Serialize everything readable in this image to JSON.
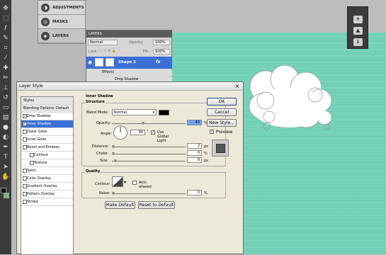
{
  "panels": {
    "dock": [
      {
        "label": "ADJUSTMENTS",
        "icon": "adjustments-icon"
      },
      {
        "label": "MASKS",
        "icon": "masks-icon"
      },
      {
        "label": "LAYERS",
        "icon": "layers-icon"
      }
    ],
    "layers": {
      "tab": "LAYERS",
      "blend_mode": "Normal",
      "opacity_label": "Opacity:",
      "opacity_value": "100%",
      "lock_label": "Lock:",
      "fill_label": "Fill:",
      "fill_value": "100%",
      "layer_name": "Shape 2",
      "fx_label": "fx",
      "effects_label": "Effects",
      "drop_shadow_label": "Drop Shadow"
    }
  },
  "dialog": {
    "title": "Layer Style",
    "styles_header": "Styles",
    "items": [
      {
        "label": "Blending Options: Default",
        "checked": null,
        "kind": "hdr"
      },
      {
        "label": "Drop Shadow",
        "checked": true,
        "kind": "main"
      },
      {
        "label": "Inner Shadow",
        "checked": true,
        "kind": "sel"
      },
      {
        "label": "Outer Glow",
        "checked": false,
        "kind": "main"
      },
      {
        "label": "Inner Glow",
        "checked": false,
        "kind": "main"
      },
      {
        "label": "Bevel and Emboss",
        "checked": false,
        "kind": "main"
      },
      {
        "label": "Contour",
        "checked": false,
        "kind": "sub"
      },
      {
        "label": "Texture",
        "checked": false,
        "kind": "sub"
      },
      {
        "label": "Satin",
        "checked": false,
        "kind": "main"
      },
      {
        "label": "Color Overlay",
        "checked": false,
        "kind": "main"
      },
      {
        "label": "Gradient Overlay",
        "checked": false,
        "kind": "main"
      },
      {
        "label": "Pattern Overlay",
        "checked": false,
        "kind": "main"
      },
      {
        "label": "Stroke",
        "checked": false,
        "kind": "main"
      }
    ],
    "section_title": "Inner Shadow",
    "structure_title": "Structure",
    "blend_mode_label": "Blend Mode:",
    "blend_mode_value": "Normal",
    "shadow_color": "#000000",
    "opacity_label": "Opacity:",
    "opacity_value": "40",
    "angle_label": "Angle:",
    "angle_value": "90",
    "use_global_light_label": "Use Global Light",
    "use_global_light": true,
    "distance_label": "Distance:",
    "distance_value": "2",
    "choke_label": "Choke:",
    "choke_value": "0",
    "size_label": "Size:",
    "size_value": "8",
    "percent_unit": "%",
    "px_unit": "px",
    "degree_unit": "°",
    "quality_title": "Quality",
    "contour_label": "Contour:",
    "anti_aliased_label": "Anti-aliased",
    "anti_aliased": false,
    "noise_label": "Noise:",
    "noise_value": "0",
    "make_default": "Make Default",
    "reset_default": "Reset to Default",
    "ok": "OK",
    "cancel": "Cancel",
    "new_style": "New Style...",
    "preview_label": "Preview",
    "preview": true
  },
  "colors": {
    "canvas": "#79d4ba",
    "selection": "#3b6fd6",
    "foreground": "#000000",
    "background_swatch": "#6cc070"
  }
}
